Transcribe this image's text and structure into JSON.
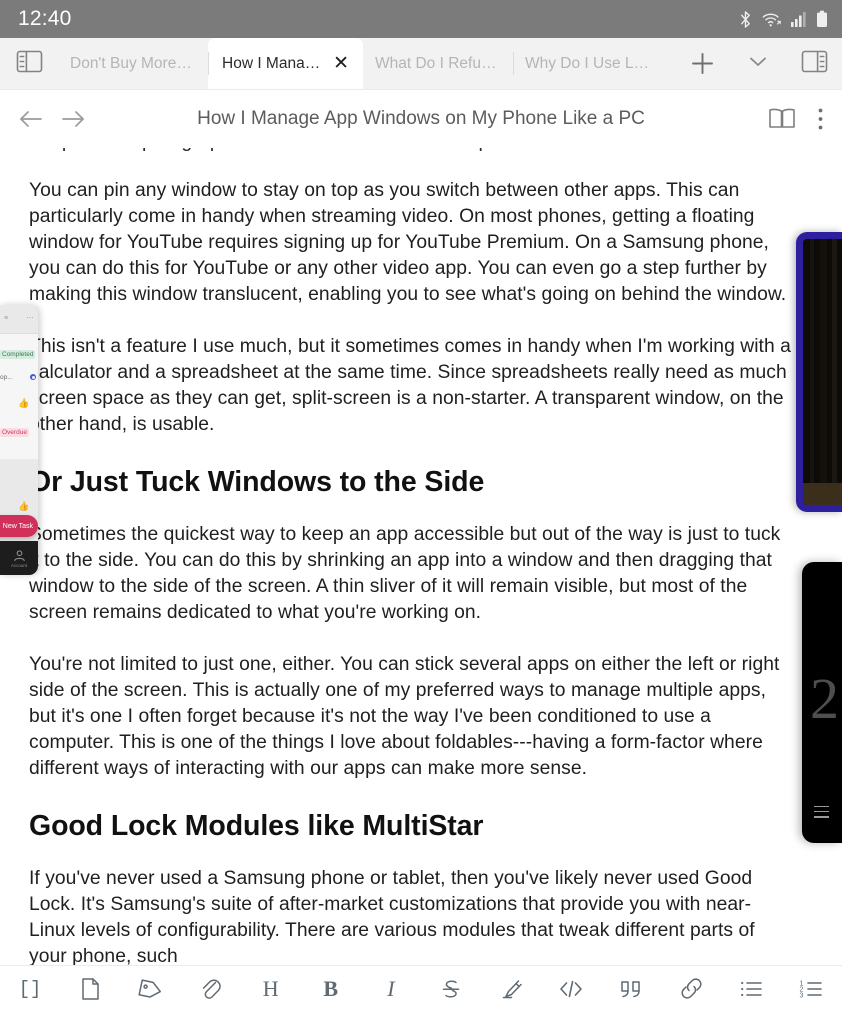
{
  "status_bar": {
    "time": "12:40",
    "icons": [
      "bluetooth-icon",
      "wifi-icon",
      "signal-icon",
      "battery-icon"
    ]
  },
  "tab_strip": {
    "left_panel_toggle": "sidebar-toggle-icon",
    "tabs": [
      {
        "label": "Don't Buy More C...",
        "active": false
      },
      {
        "label": "How I Manage...",
        "active": true,
        "close": "✕"
      },
      {
        "label": "What Do I Refuse t...",
        "active": false
      },
      {
        "label": "Why Do I Use Linu...",
        "active": false
      }
    ],
    "new_tab": "+",
    "tab_list_chevron": "chevron-down-icon",
    "right_panel_toggle": "right-panel-icon"
  },
  "nav_bar": {
    "back": "back-arrow-icon",
    "forward": "forward-arrow-icon",
    "title": "How I Manage App Windows on My Phone Like a PC",
    "reader": "book-icon",
    "overflow": "more-vertical-icon"
  },
  "article": {
    "clipped_top_line": "the previous paragraph line scrolled above the viewport",
    "blocks": [
      {
        "type": "p",
        "text": "You can pin any window to stay on top as you switch between other apps. This can particularly come in handy when streaming video. On most phones, getting a floating window for YouTube requires signing up for YouTube Premium. On a Samsung phone, you can do this for YouTube or any other video app. You can even go a step further by making this window translucent, enabling you to see what's going on behind the window."
      },
      {
        "type": "p",
        "text": "This isn't a feature I use much, but it sometimes comes in handy when I'm working with a calculator and a spreadsheet at the same time. Since spreadsheets really need as much screen space as they can get, split-screen is a non-starter. A transparent window, on the other hand, is usable."
      },
      {
        "type": "h2",
        "text": "Or Just Tuck Windows to the Side"
      },
      {
        "type": "p",
        "text": "Sometimes the quickest way to keep an app accessible but out of the way is just to tuck it to the side. You can do this by shrinking an app into a window and then dragging that window to the side of the screen. A thin sliver of it will remain visible, but most of the screen remains dedicated to what you're working on."
      },
      {
        "type": "p",
        "text": "You're not limited to just one, either. You can stick several apps on either the left or right side of the screen. This is actually one of my preferred ways to manage multiple apps, but it's one I often forget because it's not the way I've been conditioned to use a computer. This is one of the things I love about foldables---having a form-factor where different ways of interacting with our apps can make more sense."
      },
      {
        "type": "h2",
        "text": "Good Lock Modules like MultiStar"
      },
      {
        "type": "p",
        "text": "If you've never used a Samsung phone or tablet, then you've likely never used Good Lock. It's Samsung's suite of after-market customizations that provide you with near-Linux levels of configurability. There are various modules that tweak different parts of your phone, such"
      }
    ]
  },
  "floating_windows": {
    "left_task_app": {
      "name": "tucked-task-app-window",
      "header_icons": [
        "list-icon",
        "more-horizontal-icon"
      ],
      "chip_completed": "Completed",
      "row_label": "op...",
      "chip_overdue": "Overdue",
      "new_task_button": "New Task",
      "nav_label": "Account",
      "accent_color": "#d0305a",
      "background_color": "#e9e9e9"
    },
    "right_blue_window": {
      "name": "tucked-video-window",
      "border_color": "#2d1f9e",
      "content_color": "#0d0b08"
    },
    "right_black_window": {
      "name": "tucked-calculator-window",
      "display_value": "2",
      "menu_icon": "hamburger-menu-icon",
      "background_color": "#000000"
    }
  },
  "toolbar": {
    "items": [
      {
        "name": "brackets-icon",
        "glyph": "[]"
      },
      {
        "name": "file-icon",
        "glyph": ""
      },
      {
        "name": "tag-icon",
        "glyph": ""
      },
      {
        "name": "paperclip-icon",
        "glyph": ""
      },
      {
        "name": "heading-icon",
        "glyph": "H"
      },
      {
        "name": "bold-icon",
        "glyph": "B"
      },
      {
        "name": "italic-icon",
        "glyph": "I"
      },
      {
        "name": "strikethrough-icon",
        "glyph": "S"
      },
      {
        "name": "highlighter-icon",
        "glyph": ""
      },
      {
        "name": "code-icon",
        "glyph": "</>"
      },
      {
        "name": "quote-icon",
        "glyph": ""
      },
      {
        "name": "link-icon",
        "glyph": ""
      },
      {
        "name": "bullet-list-icon",
        "glyph": ""
      },
      {
        "name": "numbered-list-icon",
        "glyph": ""
      }
    ]
  }
}
